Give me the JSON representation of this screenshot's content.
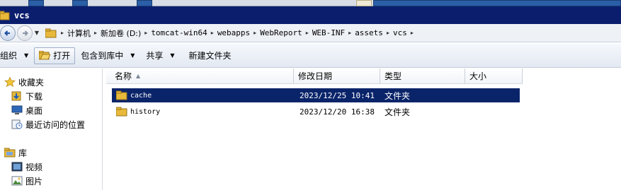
{
  "window": {
    "title": "vcs"
  },
  "address": {
    "crumbs": [
      "计算机",
      "新加卷 (D:)",
      "tomcat-win64",
      "webapps",
      "WebReport",
      "WEB-INF",
      "assets",
      "vcs"
    ]
  },
  "toolbar": {
    "organize_label": "组织",
    "open_label": "打开",
    "include_library_label": "包含到库中",
    "share_label": "共享",
    "new_folder_label": "新建文件夹"
  },
  "navpane": {
    "favorites_label": "收藏夹",
    "downloads_label": "下载",
    "desktop_label": "桌面",
    "recent_label": "最近访问的位置",
    "libraries_label": "库",
    "videos_label": "视频",
    "pictures_label": "图片"
  },
  "columns": {
    "name": "名称",
    "modified": "修改日期",
    "type": "类型",
    "size": "大小"
  },
  "files": [
    {
      "name": "cache",
      "modified": "2023/12/25 10:41",
      "type": "文件夹",
      "selected": true
    },
    {
      "name": "history",
      "modified": "2023/12/20 16:38",
      "type": "文件夹",
      "selected": false
    }
  ],
  "colors": {
    "titlebar": "#0b1e6e",
    "selection": "#0a246a",
    "folder": "#e8b93a"
  },
  "icons": [
    "back-arrow-icon",
    "forward-arrow-icon",
    "folder-icon",
    "star-icon",
    "download-icon",
    "desktop-icon",
    "recent-places-icon",
    "library-icon",
    "video-icon",
    "picture-icon",
    "sort-up-icon",
    "chevron-down-icon"
  ]
}
